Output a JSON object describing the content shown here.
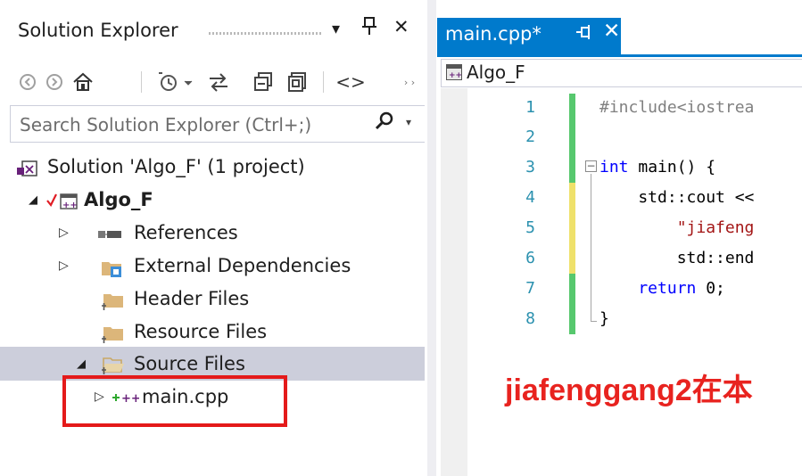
{
  "solution_explorer": {
    "title": "Solution Explorer",
    "header_buttons": {
      "dropdown": "▾",
      "pin": "⊥",
      "close": "✕"
    },
    "toolbar": [
      "back-icon",
      "forward-icon",
      "home-icon",
      "history-icon",
      "sync-icon",
      "collapse-all-icon",
      "show-all-files-icon",
      "code-view-icon"
    ],
    "search_placeholder": "Search Solution Explorer (Ctrl+;)",
    "tree": {
      "solution": "Solution 'Algo_F' (1 project)",
      "project": "Algo_F",
      "references": "References",
      "external_dependencies": "External Dependencies",
      "header_files": "Header Files",
      "resource_files": "Resource Files",
      "source_files": "Source Files",
      "main_cpp": "main.cpp"
    }
  },
  "editor": {
    "tab_title": "main.cpp*",
    "tab_pin": "⊥",
    "tab_close": "✕",
    "nav_scope": "Algo_F",
    "line_numbers": [
      "1",
      "2",
      "3",
      "4",
      "5",
      "6",
      "7",
      "8"
    ],
    "code": {
      "line1": "#include<iostrea",
      "line3_kw": "int",
      "line3_rest": " main() {",
      "line4": "    std::cout <<",
      "line5": "        \"jiafeng",
      "line6": "        std::end",
      "line7_kw": "    return",
      "line7_rest": " 0;",
      "line8": "}"
    },
    "colors": {
      "accent": "#007acc",
      "changed_saved": "#57c86e",
      "changed_unsaved": "#efe16b"
    }
  },
  "watermark": "jiafenggang2在本"
}
